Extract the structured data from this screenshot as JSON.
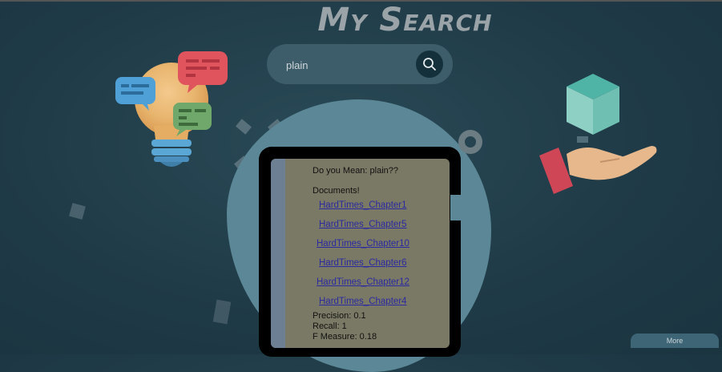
{
  "title": "My Search",
  "search": {
    "value": "plain"
  },
  "results": {
    "suggestion": "Do you Mean: plain??",
    "documents_heading": "Documents!",
    "documents": [
      "HardTimes_Chapter1",
      "HardTimes_Chapter5",
      "HardTimes_Chapter10",
      "HardTimes_Chapter6",
      "HardTimes_Chapter12",
      "HardTimes_Chapter4"
    ],
    "precision": "Precision: 0.1",
    "recall": "Recall: 1",
    "f_measure": "F Measure: 0.18"
  },
  "more_label": "More",
  "icons": {
    "search": "search-icon",
    "lightbulb": "lightbulb-chat-illustration",
    "hand_box": "hand-holding-box-illustration"
  }
}
